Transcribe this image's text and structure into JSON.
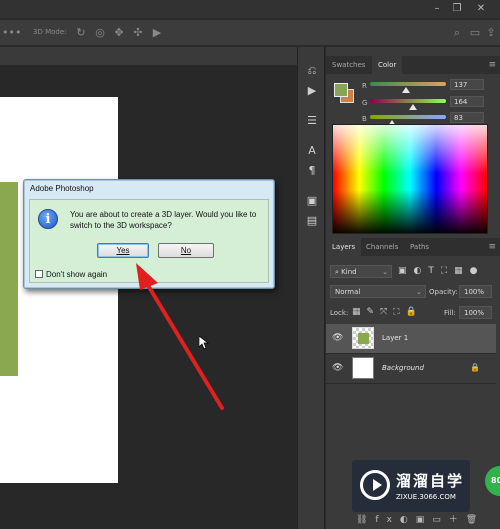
{
  "app": {
    "title": "Adobe Photoshop"
  },
  "options_bar": {
    "mode_label": "3D Mode:"
  },
  "panels": {
    "swatches_tab": "Swatches",
    "color_tab": "Color",
    "color": {
      "r_label": "R",
      "g_label": "G",
      "b_label": "B",
      "r": "137",
      "g": "164",
      "b": "83",
      "foreground": "#89a453",
      "background": "#c8824a"
    },
    "layers_tab": "Layers",
    "channels_tab": "Channels",
    "paths_tab": "Paths",
    "kind_filter": "Kind",
    "blend_mode": "Normal",
    "opacity_label": "Opacity:",
    "opacity_value": "100%",
    "lock_label": "Lock:",
    "fill_label": "Fill:",
    "fill_value": "100%",
    "layers": [
      {
        "name": "Layer 1"
      },
      {
        "name": "Background"
      }
    ]
  },
  "dialog": {
    "title": "Adobe Photoshop",
    "message": "You are about to create a 3D layer.  Would you like to switch to the 3D workspace?",
    "yes_label": "Yes",
    "no_label": "No",
    "dont_show_label": "Don't show again"
  },
  "watermark": {
    "cn": "溜溜自学",
    "url": "ZIXUE.3066.COM",
    "badge": "80"
  },
  "colors": {
    "accent_red": "#e0201e",
    "layer_green": "#89a84f"
  }
}
